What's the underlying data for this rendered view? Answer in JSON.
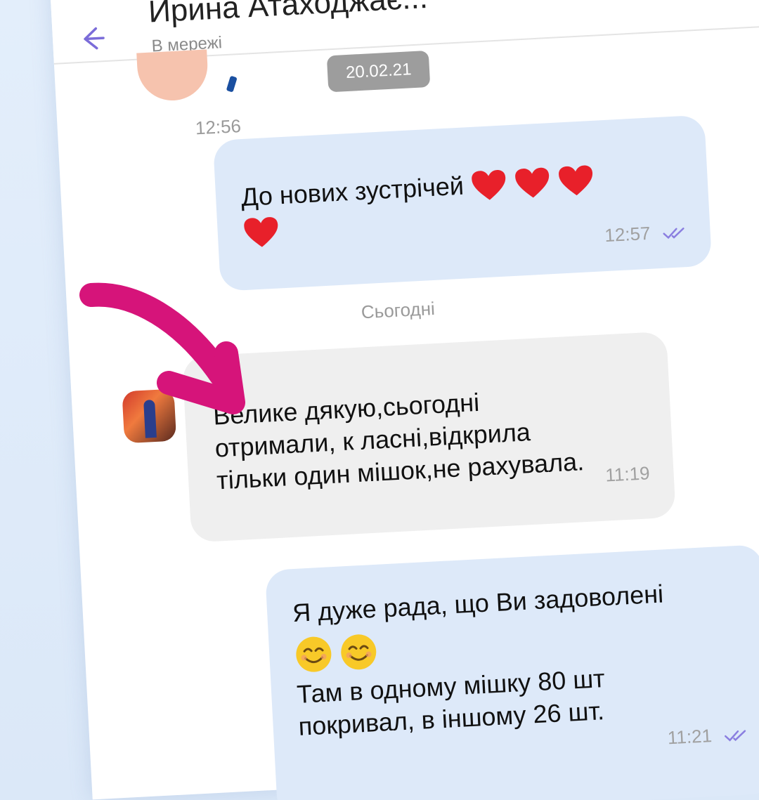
{
  "header": {
    "back_icon": "arrow-left-icon",
    "contact_name": "Ирина Атаходжає...",
    "status": "В мережі",
    "call_icon": "phone-icon",
    "video_icon": "video-camera-icon"
  },
  "chat": {
    "date_pill": "20.02.21",
    "loose_time": "12:56",
    "messages": [
      {
        "direction": "outgoing",
        "text": "До нових зустрічей",
        "emoji": [
          "heart",
          "heart",
          "heart",
          "heart"
        ],
        "time": "12:57",
        "status": "read"
      },
      {
        "direction": "incoming",
        "lines": [
          "Велике дякую,сьогодні",
          "отримали, к ласні,відкрила",
          "тільки один мішок,не рахувала."
        ],
        "time": "11:19"
      },
      {
        "direction": "outgoing",
        "lines": [
          "Я дуже рада, що Ви задоволені",
          "Там в одному мішку 80 шт",
          "покривал, в іншому 26 шт."
        ],
        "emoji": [
          "smiling-face",
          "smiling-face"
        ],
        "time": "11:21",
        "status": "read"
      }
    ],
    "day_separator": "Сьогодні"
  },
  "colors": {
    "accent": "#7b6cd9",
    "outgoing_bubble": "#dde9f9",
    "incoming_bubble": "#efefef",
    "annotation_arrow": "#d6147a",
    "heart": "#e8202a"
  }
}
